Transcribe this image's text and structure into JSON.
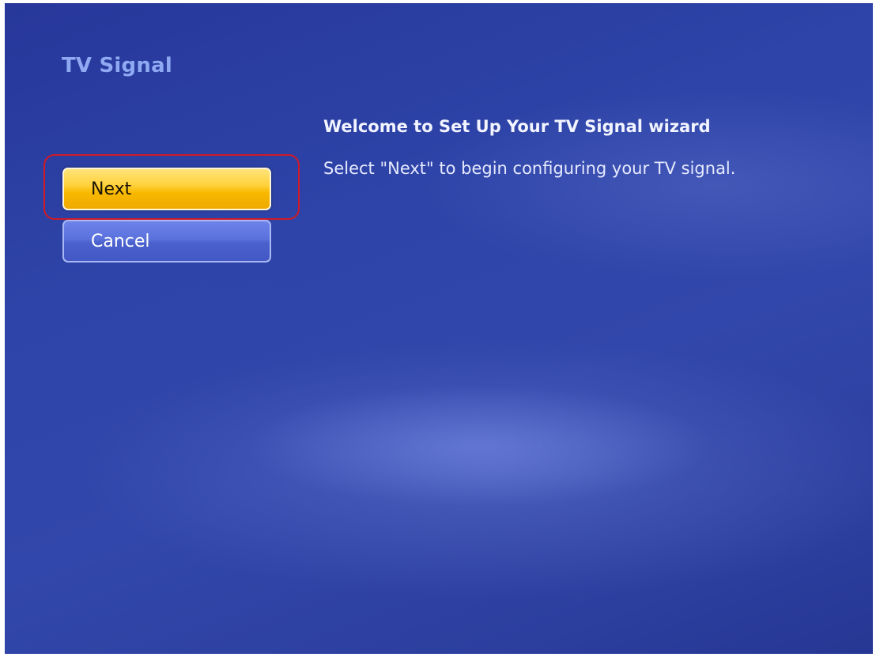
{
  "page": {
    "title": "TV Signal"
  },
  "buttons": {
    "next_label": "Next",
    "cancel_label": "Cancel"
  },
  "content": {
    "heading": "Welcome to Set Up Your TV Signal wizard",
    "instruction": "Select \"Next\" to begin configuring your TV signal."
  },
  "colors": {
    "background": "#2e44a8",
    "title": "#8fa9f2",
    "focused_button": "#ffd23c",
    "button": "#5a71dc",
    "focus_ring": "#d11a26"
  }
}
